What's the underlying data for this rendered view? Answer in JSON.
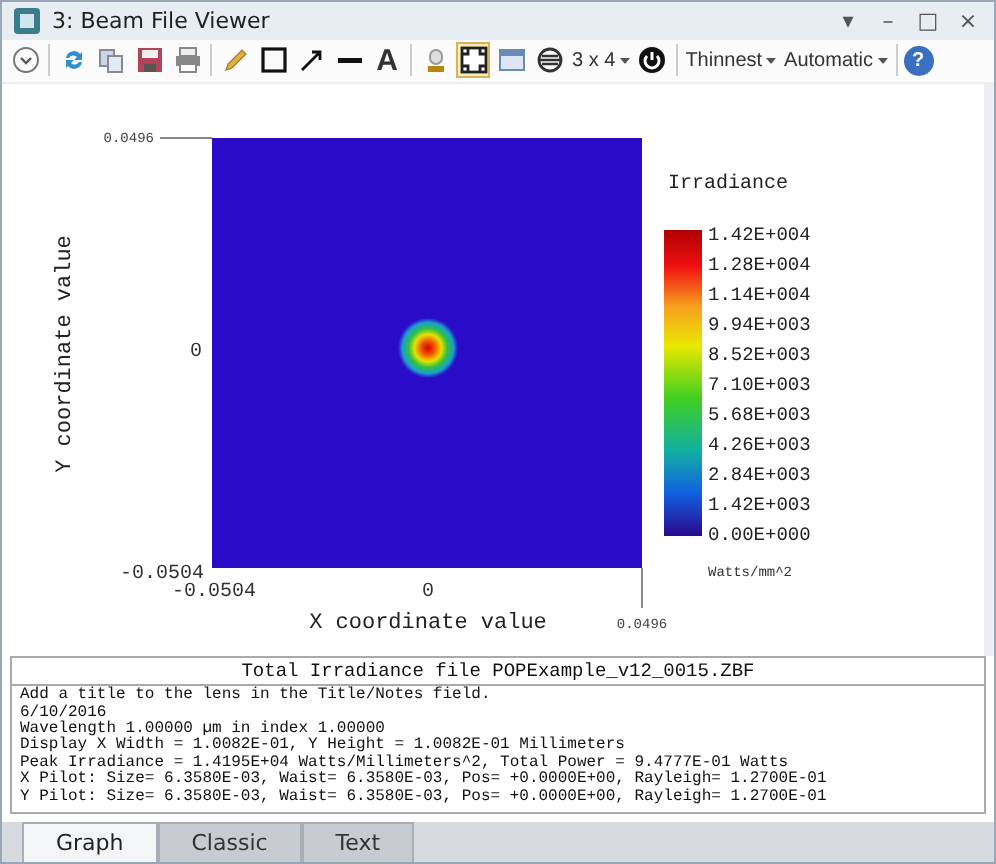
{
  "window": {
    "title": "3: Beam File Viewer",
    "controls": [
      "▾",
      "–",
      "□",
      "×"
    ]
  },
  "toolbar": {
    "text_tool": "A",
    "frame_toggle": {
      "selected": true
    },
    "layout": "3 x 4",
    "line_style": "Thinnest",
    "scale": "Automatic",
    "help": "?"
  },
  "plot": {
    "y_axis_label": "Y coordinate value",
    "x_axis_label": "X coordinate value",
    "y_ticks": [
      "0.0496",
      "0",
      "-0.0504"
    ],
    "x_ticks": [
      "-0.0504",
      "0",
      "0.0496"
    ],
    "legend": {
      "title": "Irradiance",
      "labels": [
        "1.42E+004",
        "1.28E+004",
        "1.14E+004",
        "9.94E+003",
        "8.52E+003",
        "7.10E+003",
        "5.68E+003",
        "4.26E+003",
        "2.84E+003",
        "1.42E+003",
        "0.00E+000"
      ],
      "unit": "Watts/mm^2"
    }
  },
  "info": {
    "header": "Total Irradiance file POPExample_v12_0015.ZBF",
    "lines": [
      "Add a title to the lens in the Title/Notes field.",
      "6/10/2016",
      "Wavelength 1.00000 µm in index 1.00000",
      "Display X Width = 1.0082E-01, Y Height = 1.0082E-01 Millimeters",
      "Peak Irradiance = 1.4195E+04 Watts/Millimeters^2, Total Power = 9.4777E-01 Watts",
      "X Pilot: Size= 6.3580E-03, Waist= 6.3580E-03, Pos= +0.0000E+00, Rayleigh= 1.2700E-01",
      "Y Pilot: Size= 6.3580E-03, Waist= 6.3580E-03, Pos= +0.0000E+00, Rayleigh= 1.2700E-01"
    ]
  },
  "tabs": [
    {
      "label": "Graph",
      "selected": true
    },
    {
      "label": "Classic",
      "selected": false
    },
    {
      "label": "Text",
      "selected": false
    }
  ]
}
